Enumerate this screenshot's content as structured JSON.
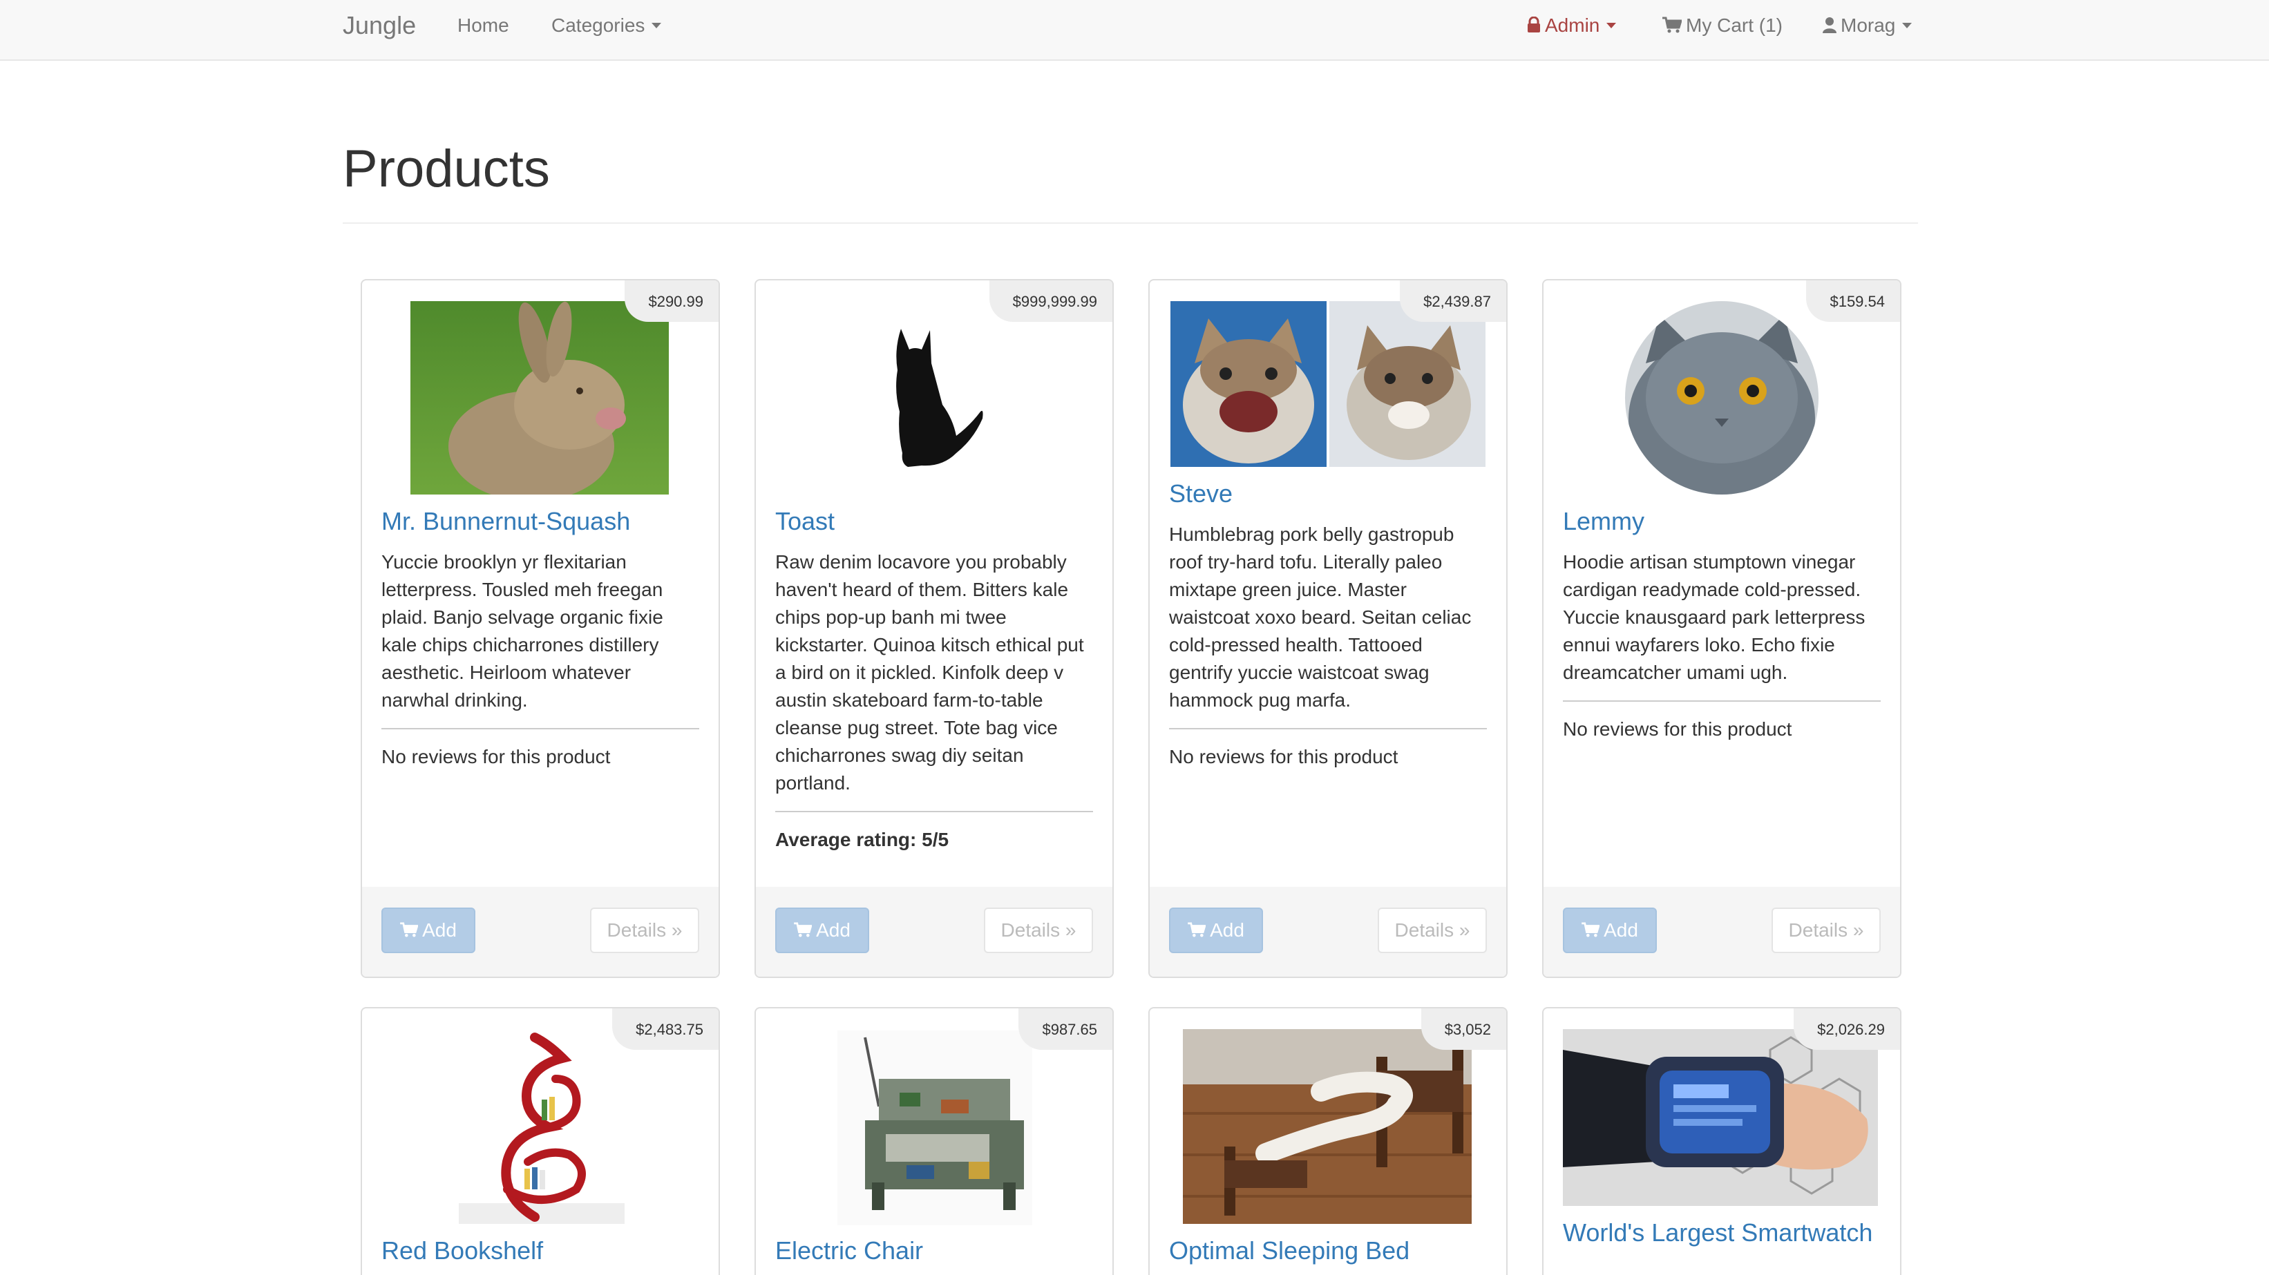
{
  "nav": {
    "brand": "Jungle",
    "home": "Home",
    "categories": "Categories",
    "admin": "Admin",
    "cart": "My Cart (1)",
    "user": "Morag"
  },
  "page": {
    "title": "Products"
  },
  "colors": {
    "link": "#337ab7",
    "admin": "#a94442",
    "add_button": "#b3cce6"
  },
  "buttons": {
    "add": "Add",
    "details": "Details »"
  },
  "products": [
    {
      "name": "Mr. Bunnernut-Squash",
      "price": "$290.99",
      "image": "rabbit-photo",
      "description": "Yuccie brooklyn yr flexitarian letterpress. Tousled meh freegan plaid. Banjo selvage organic fixie kale chips chicharrones distillery aesthetic. Heirloom whatever narwhal drinking.",
      "review": "No reviews for this product"
    },
    {
      "name": "Toast",
      "price": "$999,999.99",
      "image": "black-cat-silhouette",
      "description": "Raw denim locavore you probably haven't heard of them. Bitters kale chips pop-up banh mi twee kickstarter. Quinoa kitsch ethical put a bird on it pickled. Kinfolk deep v austin skateboard farm-to-table cleanse pug street. Tote bag vice chicharrones swag diy seitan portland.",
      "review": "Average rating: 5/5"
    },
    {
      "name": "Steve",
      "price": "$2,439.87",
      "image": "two-laughing-cats-photo",
      "description": "Humblebrag pork belly gastropub roof try-hard tofu. Literally paleo mixtape green juice. Master waistcoat xoxo beard. Seitan celiac cold-pressed health. Tattooed gentrify yuccie waistcoat swag hammock pug marfa.",
      "review": "No reviews for this product"
    },
    {
      "name": "Lemmy",
      "price": "$159.54",
      "image": "grey-cat-circle-photo",
      "description": "Hoodie artisan stumptown vinegar cardigan readymade cold-pressed. Yuccie knausgaard park letterpress ennui wayfarers loko. Echo fixie dreamcatcher umami ugh.",
      "review": "No reviews for this product"
    },
    {
      "name": "Red Bookshelf",
      "price": "$2,483.75",
      "image": "red-tree-bookshelf"
    },
    {
      "name": "Electric Chair",
      "price": "$987.65",
      "image": "circuit-board-armchair"
    },
    {
      "name": "Optimal Sleeping Bed",
      "price": "$3,052",
      "image": "curved-wooden-bed-photo"
    },
    {
      "name": "World's Largest Smartwatch",
      "price": "$2,026.29",
      "image": "wrist-smartwatch-photo"
    }
  ]
}
